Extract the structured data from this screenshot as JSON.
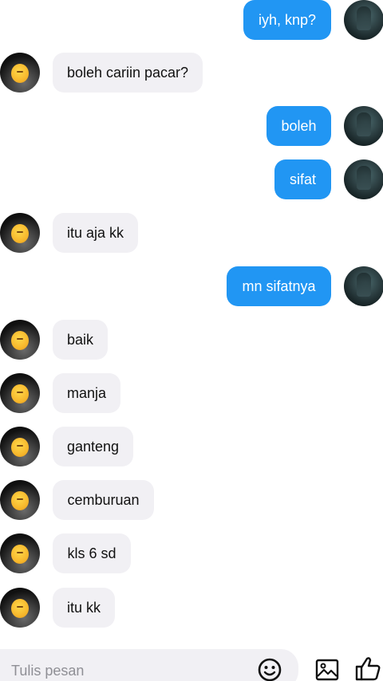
{
  "conversation": {
    "messages": [
      {
        "side": "out",
        "text": "iyh, knp?"
      },
      {
        "side": "in",
        "text": "boleh cariin pacar?"
      },
      {
        "side": "out",
        "text": "boleh"
      },
      {
        "side": "out",
        "text": "sifat"
      },
      {
        "side": "in",
        "text": "itu aja kk"
      },
      {
        "side": "out",
        "text": "mn sifatnya"
      },
      {
        "side": "in",
        "text": "baik"
      },
      {
        "side": "in",
        "text": "manja"
      },
      {
        "side": "in",
        "text": "ganteng"
      },
      {
        "side": "in",
        "text": "cemburuan"
      },
      {
        "side": "in",
        "text": "kls 6 sd"
      },
      {
        "side": "in",
        "text": "itu kk"
      }
    ]
  },
  "composer": {
    "placeholder": "Tulis pesan",
    "value": "",
    "icons": [
      "emoji-icon",
      "image-icon",
      "like-icon"
    ]
  },
  "colors": {
    "outgoing_bubble": "#2196f3",
    "incoming_bubble": "#f1f0f4",
    "background": "#ffffff"
  }
}
